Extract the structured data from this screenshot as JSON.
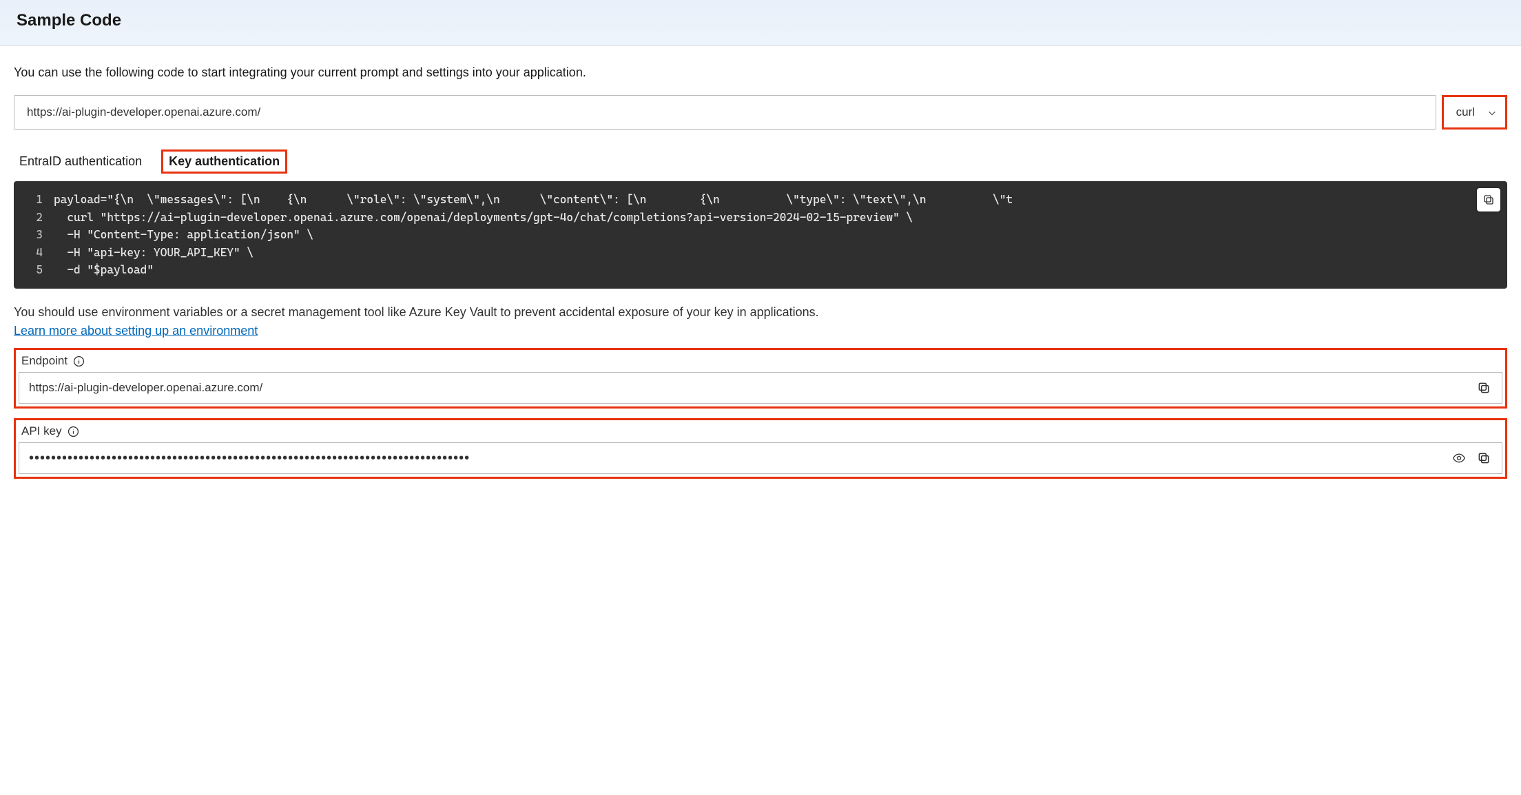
{
  "title": "Sample Code",
  "intro": "You can use the following code to start integrating your current prompt and settings into your application.",
  "endpoint_url": "https://ai-plugin-developer.openai.azure.com/",
  "language_selected": "curl",
  "tabs": {
    "entra": "EntraID authentication",
    "key": "Key authentication"
  },
  "active_tab": "key",
  "code": {
    "lines": [
      "payload=\"{\\n  \\\"messages\\\": [\\n    {\\n      \\\"role\\\": \\\"system\\\",\\n      \\\"content\\\": [\\n        {\\n          \\\"type\\\": \\\"text\\\",\\n          \\\"t",
      "  curl \"https://ai-plugin-developer.openai.azure.com/openai/deployments/gpt-4o/chat/completions?api-version=2024-02-15-preview\" \\",
      "  -H \"Content-Type: application/json\" \\",
      "  -H \"api-key: YOUR_API_KEY\" \\",
      "  -d \"$payload\""
    ]
  },
  "note": "You should use environment variables or a secret management tool like Azure Key Vault to prevent accidental exposure of your key in applications.",
  "learn_more": "Learn more about setting up an environment",
  "fields": {
    "endpoint_label": "Endpoint",
    "endpoint_value": "https://ai-plugin-developer.openai.azure.com/",
    "apikey_label": "API key",
    "apikey_masked": "••••••••••••••••••••••••••••••••••••••••••••••••••••••••••••••••••••••••••••••••"
  }
}
